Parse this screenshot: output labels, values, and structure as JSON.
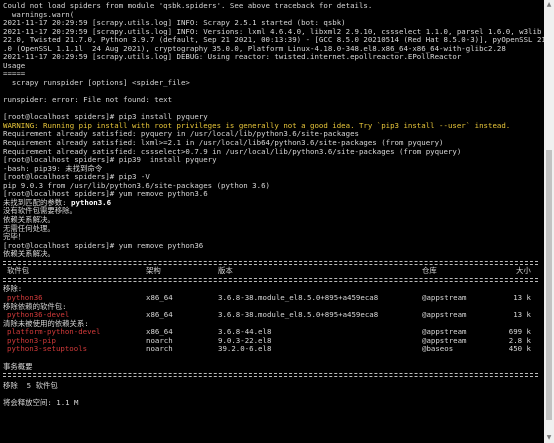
{
  "lines": [
    {
      "text": "Could not load spiders from module 'qsbk.spiders'. See above traceback for details.",
      "cls": ""
    },
    {
      "text": "  warnings.warn(",
      "cls": ""
    },
    {
      "text": "2021-11-17 20:29:59 [scrapy.utils.log] INFO: Scrapy 2.5.1 started (bot: qsbk)",
      "cls": ""
    },
    {
      "text": "2021-11-17 20:29:59 [scrapy.utils.log] INFO: Versions: lxml 4.6.4.0, libxml2 2.9.10, cssselect 1.1.0, parsel 1.6.0, w3lib 1.",
      "cls": ""
    },
    {
      "text": "22.0, Twisted 21.7.0, Python 3.9.7 (default, Sep 21 2021, 00:13:39) - [GCC 8.5.0 20210514 (Red Hat 8.5.0-3)], pyOpenSSL 21.0",
      "cls": ""
    },
    {
      "text": ".0 (OpenSSL 1.1.1l  24 Aug 2021), cryptography 35.0.0, Platform Linux-4.18.0-348.el8.x86_64-x86_64-with-glibc2.28",
      "cls": ""
    },
    {
      "text": "2021-11-17 20:29:59 [scrapy.utils.log] DEBUG: Using reactor: twisted.internet.epollreactor.EPollReactor",
      "cls": ""
    },
    {
      "text": "Usage",
      "cls": ""
    },
    {
      "text": "=====",
      "cls": ""
    },
    {
      "text": "  scrapy runspider [options] <spider_file>",
      "cls": ""
    },
    {
      "text": "",
      "cls": ""
    },
    {
      "text": "runspider: error: File not found: text",
      "cls": ""
    },
    {
      "text": "",
      "cls": ""
    },
    {
      "text": "[root@localhost spiders]# pip3 install pyquery",
      "cls": ""
    },
    {
      "text": "WARNING: Running pip install with root privileges is generally not a good idea. Try `pip3 install --user` instead.",
      "cls": "warn"
    },
    {
      "text": "Requirement already satisfied: pyquery in /usr/local/lib/python3.6/site-packages",
      "cls": ""
    },
    {
      "text": "Requirement already satisfied: lxml>=2.1 in /usr/local/lib64/python3.6/site-packages (from pyquery)",
      "cls": ""
    },
    {
      "text": "Requirement already satisfied: cssselect>0.7.9 in /usr/local/lib/python3.6/site-packages (from pyquery)",
      "cls": ""
    },
    {
      "text": "[root@localhost spiders]# pip39  install pyquery",
      "cls": ""
    },
    {
      "text": "-bash: pip39: 未找到命令",
      "cls": ""
    },
    {
      "text": "[root@localhost spiders]# pip3 -V",
      "cls": ""
    },
    {
      "text": "pip 9.0.3 from /usr/lib/python3.6/site-packages (python 3.6)",
      "cls": ""
    },
    {
      "text": "[root@localhost spiders]# yum remove python3.6",
      "cls": ""
    },
    {
      "text": "未找到匹配的参数: python3.6",
      "cls": "",
      "bold_suffix": "python3.6",
      "prefix": "未找到匹配的参数: "
    },
    {
      "text": "没有软件包需要移除。",
      "cls": ""
    },
    {
      "text": "依赖关系解决。",
      "cls": ""
    },
    {
      "text": "无需任何处理。",
      "cls": ""
    },
    {
      "text": "完毕！",
      "cls": ""
    },
    {
      "text": "[root@localhost spiders]# yum remove python36",
      "cls": ""
    },
    {
      "text": "依赖关系解决。",
      "cls": ""
    }
  ],
  "table": {
    "headers": {
      "pkg": "软件包",
      "arch": "架构",
      "ver": "版本",
      "repo": "仓库",
      "size": "大小"
    },
    "sections": [
      {
        "title": "移除:",
        "rows": [
          {
            "pkg": "python36",
            "arch": "x86_64",
            "ver": "3.6.8-38.module_el8.5.0+895+a459eca8",
            "repo": "@appstream",
            "size": "13 k"
          }
        ]
      },
      {
        "title": "移除依赖的软件包:",
        "rows": [
          {
            "pkg": "python36-devel",
            "arch": "x86_64",
            "ver": "3.6.8-38.module_el8.5.0+895+a459eca8",
            "repo": "@appstream",
            "size": "13 k"
          }
        ]
      },
      {
        "title": "清除未被使用的依赖关系:",
        "rows": [
          {
            "pkg": "platform-python-devel",
            "arch": "x86_64",
            "ver": "3.6.8-44.el8",
            "repo": "@appstream",
            "size": "699 k"
          },
          {
            "pkg": "python3-pip",
            "arch": "noarch",
            "ver": "9.0.3-22.el8",
            "repo": "@appstream",
            "size": "2.8 k"
          },
          {
            "pkg": "python3-setuptools",
            "arch": "noarch",
            "ver": "39.2.0-6.el8",
            "repo": "@baseos",
            "size": "450 k"
          }
        ]
      }
    ]
  },
  "summary": {
    "title": "事务概要",
    "remove": "移除  5 软件包",
    "freed": "将会释放空间: 1.1 M"
  },
  "colors": {
    "background": "#000000",
    "text": "#d8d8d8",
    "warning": "#e9c73a",
    "package": "#d23a3a"
  }
}
